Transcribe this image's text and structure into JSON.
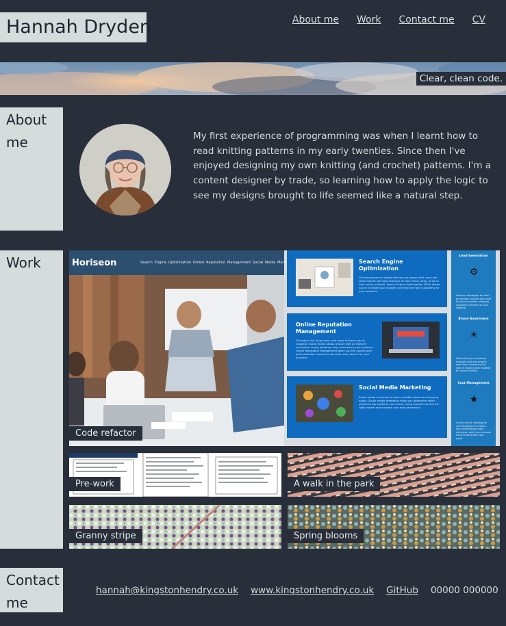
{
  "header": {
    "name": "Hannah Dryden",
    "nav": [
      "About me",
      "Work",
      "Contact me",
      "CV"
    ]
  },
  "hero": {
    "tagline": "Clear, clean code."
  },
  "about": {
    "heading": "About me",
    "text": "My first experience of programming was when I learnt how to read knitting patterns in my early twenties. Since then I've enjoyed designing my own knitting (and crochet) patterns. I'm a content designer by trade, so learning how to apply the logic to see my designs brought to life seemed like a natural step."
  },
  "work": {
    "heading": "Work",
    "tiles": [
      {
        "label": "Code refactor"
      },
      {
        "label": "Pre-work"
      },
      {
        "label": "A walk in the park"
      },
      {
        "label": "Granny stripe"
      },
      {
        "label": "Spring blooms"
      }
    ],
    "preview": {
      "brand": "Horiseon",
      "nav": "Search Engine Optimization     Online Reputation Management     Social Media Marketing",
      "cards": [
        {
          "title": "Search Engine Optimization",
          "text": "The dominance of mobile internet use means that users are searching for the right business as they travel, shop, or sit on their couch at home. Search Engine Optimization (SEO) allows you to increase your visibility and find the right customers for your business."
        },
        {
          "title": "Online Reputation Management",
          "text": "The web is full of opinions, and some of these can be negative. Social media allows anyone with an internet connection to say whatever they want about your business. Online Reputation Management gives you the control over what potential customers see when they search for your business."
        },
        {
          "title": "Social Media Marketing",
          "text": "Social media continues to have a sizable influence on buying habits. Social media marketing helps you determine which platforms are suited to your brand, using analytics to find the right market and increase your lead generation."
        }
      ],
      "side": [
        {
          "title": "Lead Generation",
          "text": "Inbound strategies for lead generation require less work for your business, bringing customers directly to your website."
        },
        {
          "title": "Brand Awareness",
          "text": "Users find your business through paid and organic searches, increasing the search ranking and visibility for your business."
        },
        {
          "title": "Cost Management",
          "text": "As the search ranking for your business increases, your advertising costs decrease, and you no longer need to advertise your page."
        }
      ]
    }
  },
  "contact": {
    "heading": "Contact me",
    "email": "hannah@kingstonhendry.co.uk",
    "website": "www.kingstonhendry.co.uk",
    "github": "GitHub",
    "phone": "00000 000000"
  }
}
